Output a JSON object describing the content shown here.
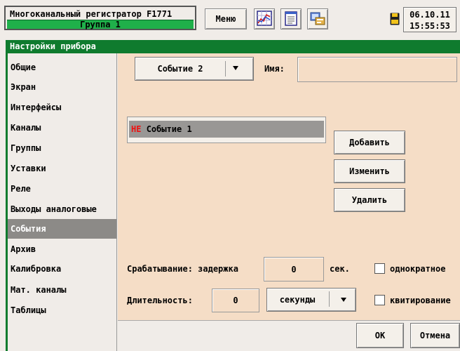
{
  "topbar": {
    "title": "Многоканальный регистратор F1771",
    "group": "Группа 1",
    "menu_label": "Меню",
    "date": "06.10.11",
    "time": "15:55:53"
  },
  "window": {
    "title": "Настройки прибора"
  },
  "sidebar": {
    "items": [
      {
        "label": "Общие"
      },
      {
        "label": "Экран"
      },
      {
        "label": "Интерфейсы"
      },
      {
        "label": "Каналы"
      },
      {
        "label": "Группы"
      },
      {
        "label": "Уставки"
      },
      {
        "label": "Реле"
      },
      {
        "label": "Выходы аналоговые"
      },
      {
        "label": "События"
      },
      {
        "label": "Архив"
      },
      {
        "label": "Калибровка"
      },
      {
        "label": "Мат. каналы"
      },
      {
        "label": "Таблицы"
      }
    ],
    "active_index": 8
  },
  "main": {
    "event_select": "Событие 2",
    "name_label": "Имя:",
    "name_value": "",
    "list": [
      {
        "prefix": "НЕ",
        "text": "Событие 1"
      }
    ],
    "add_label": "Добавить",
    "edit_label": "Изменить",
    "delete_label": "Удалить",
    "trigger_label": "Срабатывание: задержка",
    "trigger_value": "0",
    "trigger_unit": "сек.",
    "single_label": "однократное",
    "duration_label": "Длительность:",
    "duration_value": "0",
    "duration_unit": "секунды",
    "ack_label": "квитирование",
    "ok_label": "ОК",
    "cancel_label": "Отмена"
  },
  "icons": [
    "chart-icon",
    "notepad-icon",
    "settings-icon",
    "floppy-disk-icon",
    "dropdown-arrow-icon"
  ],
  "colors": {
    "accent_green": "#0f7b2e",
    "group_green": "#1fb04a",
    "panel_bg": "#f5ddc6",
    "negation_red": "#e11111"
  }
}
